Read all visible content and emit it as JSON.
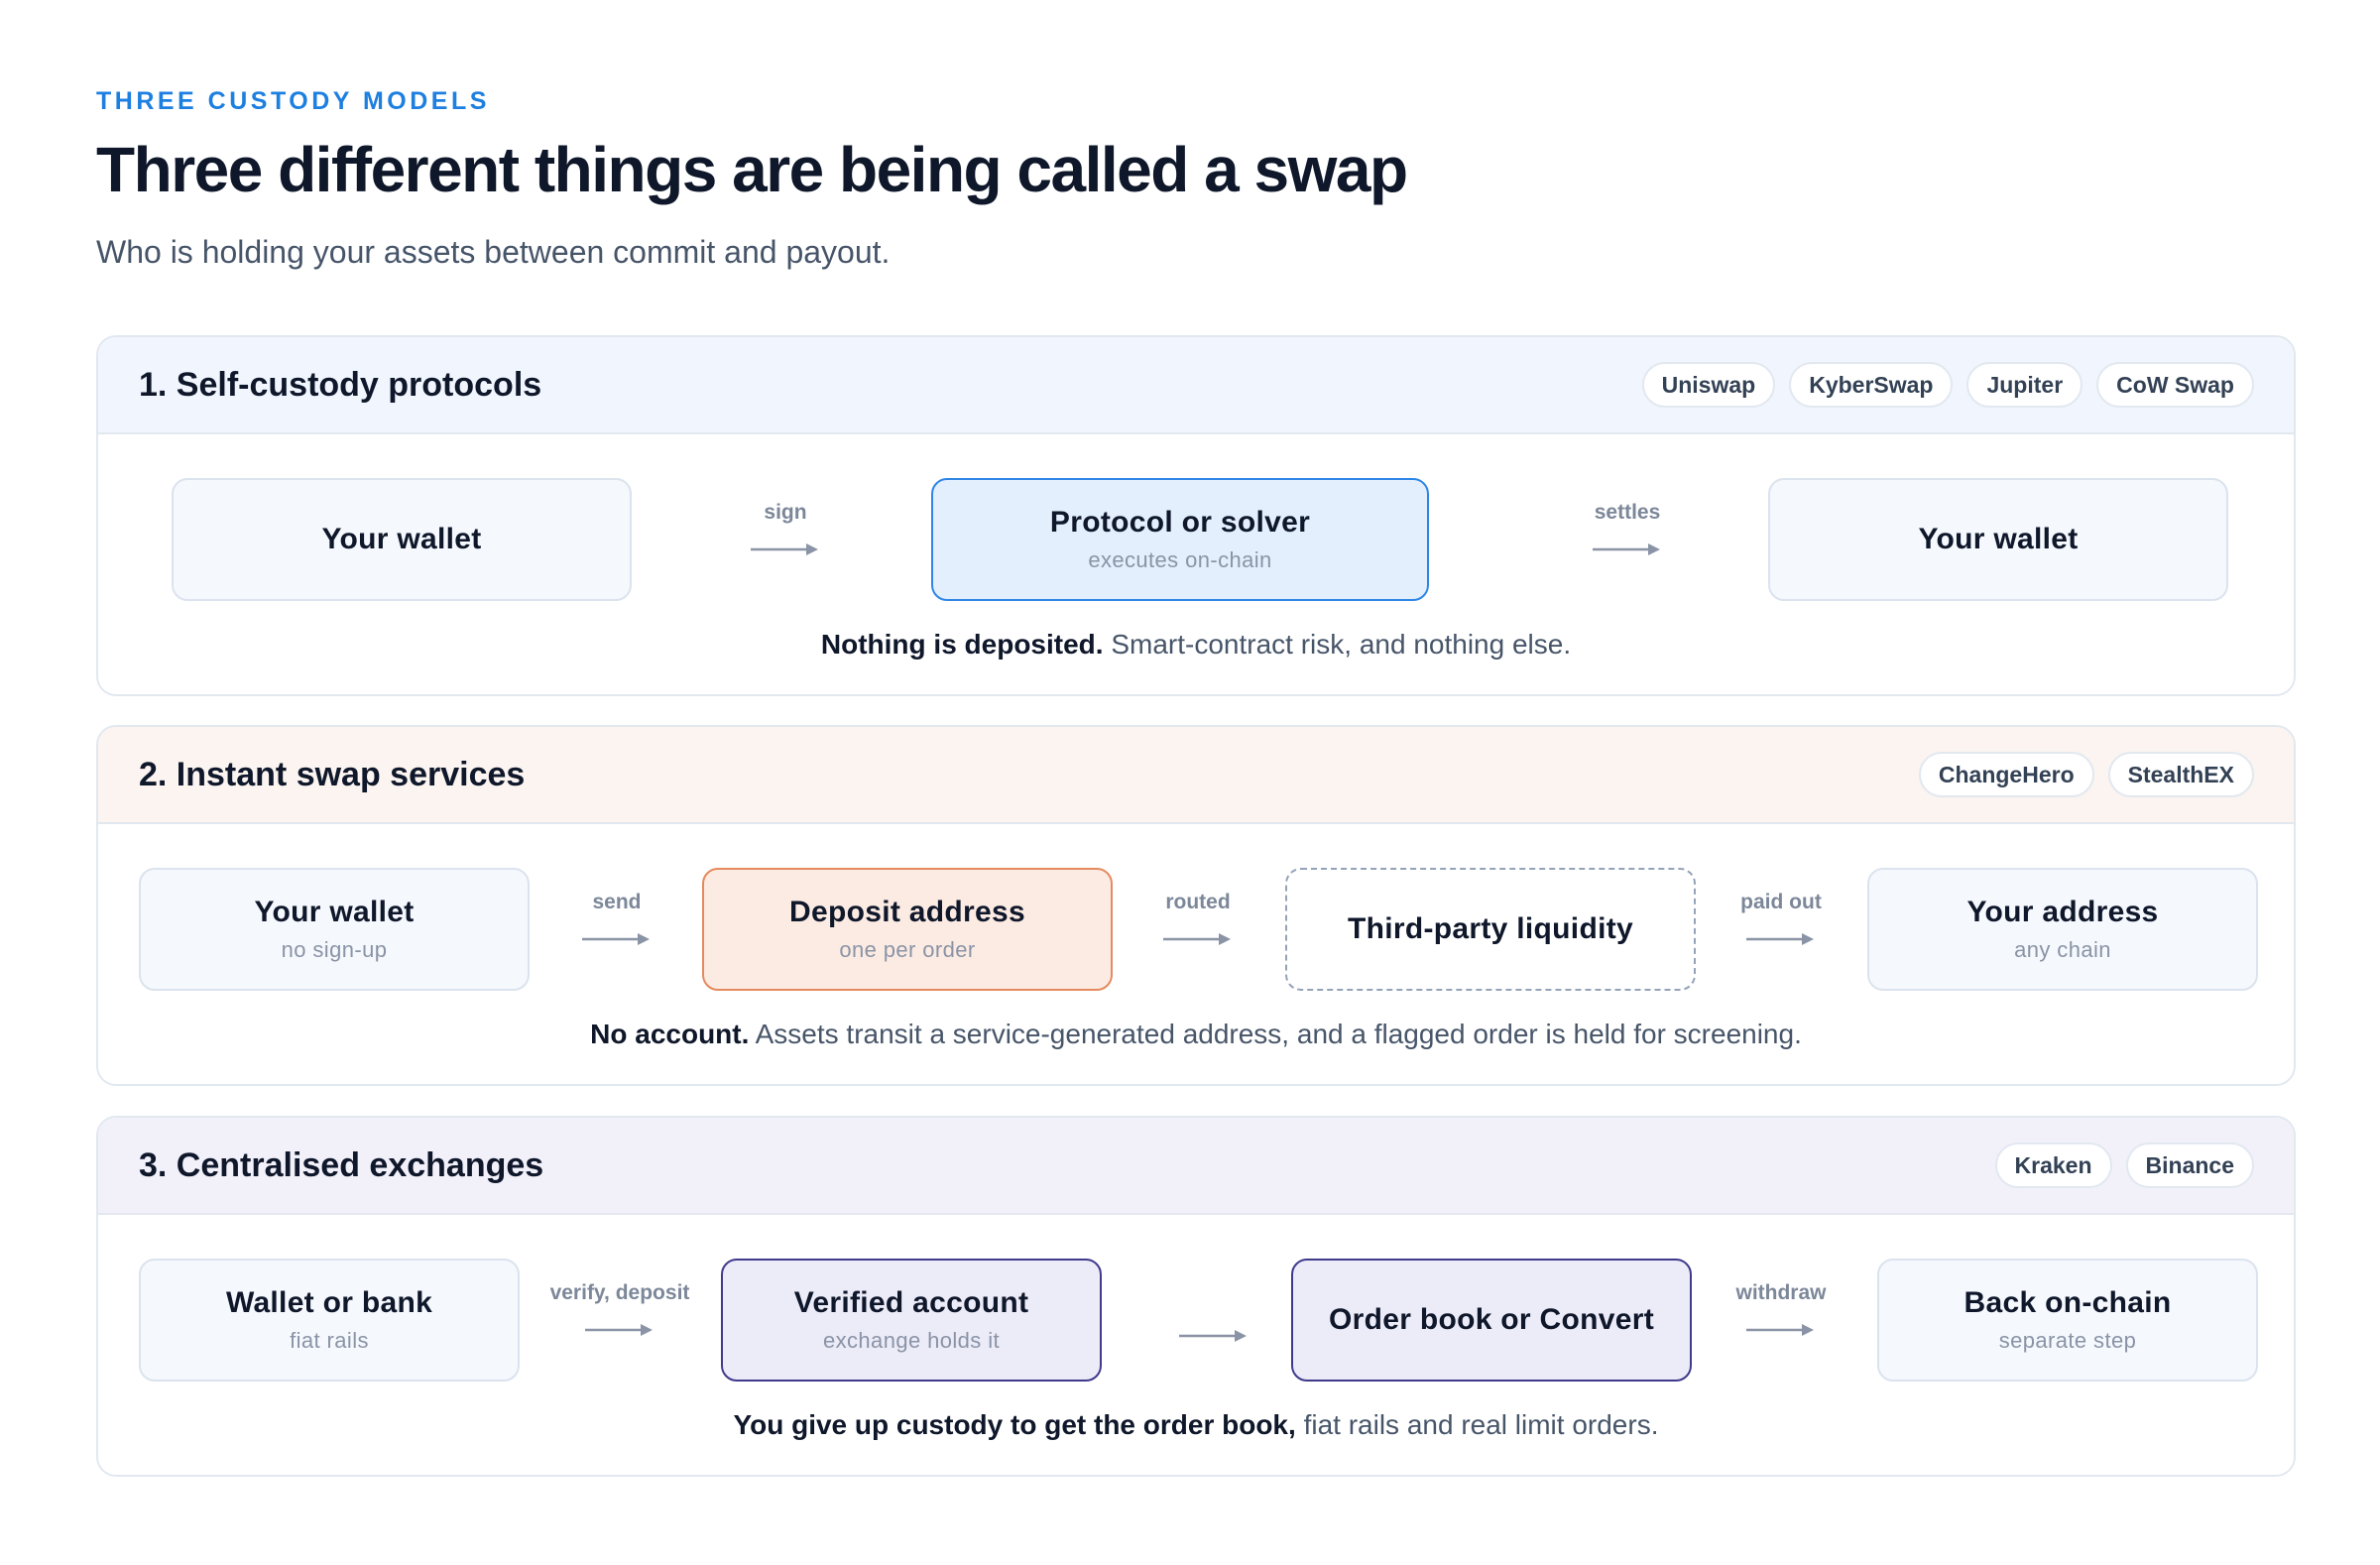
{
  "header": {
    "eyebrow": "THREE CUSTODY MODELS",
    "title": "Three different things are being called a swap",
    "subtitle": "Who is holding your assets between commit and payout."
  },
  "panels": [
    {
      "title": "1. Self-custody protocols",
      "chips": [
        "Uniswap",
        "KyberSwap",
        "Jupiter",
        "CoW Swap"
      ],
      "nodes": [
        {
          "label": "Your wallet",
          "sub": ""
        },
        {
          "label": "Protocol or solver",
          "sub": "executes on-chain"
        },
        {
          "label": "Your wallet",
          "sub": ""
        }
      ],
      "connectors": [
        "sign",
        "settles"
      ],
      "note_bold": "Nothing is deposited.",
      "note_rest": " Smart-contract risk, and nothing else."
    },
    {
      "title": "2. Instant swap services",
      "chips": [
        "ChangeHero",
        "StealthEX"
      ],
      "nodes": [
        {
          "label": "Your wallet",
          "sub": "no sign-up"
        },
        {
          "label": "Deposit address",
          "sub": "one per order"
        },
        {
          "label": "Third-party liquidity",
          "sub": ""
        },
        {
          "label": "Your address",
          "sub": "any chain"
        }
      ],
      "connectors": [
        "send",
        "routed",
        "paid out"
      ],
      "note_bold": "No account.",
      "note_rest": " Assets transit a service-generated address, and a flagged order is held for screening."
    },
    {
      "title": "3. Centralised exchanges",
      "chips": [
        "Kraken",
        "Binance"
      ],
      "nodes": [
        {
          "label": "Wallet or bank",
          "sub": "fiat rails"
        },
        {
          "label": "Verified account",
          "sub": "exchange holds it"
        },
        {
          "label": "Order book or Convert",
          "sub": ""
        },
        {
          "label": "Back on-chain",
          "sub": "separate step"
        }
      ],
      "connectors": [
        "verify, deposit",
        "",
        "withdraw"
      ],
      "note_bold": "You give up custody to get the order book,",
      "note_rest": " fiat rails and real limit orders."
    }
  ],
  "colors": {
    "accent": "#1d7fe0",
    "protocol_node": "#e3effd",
    "deposit_node": "#fcebe3",
    "exchange_node": "#ecebf8"
  }
}
